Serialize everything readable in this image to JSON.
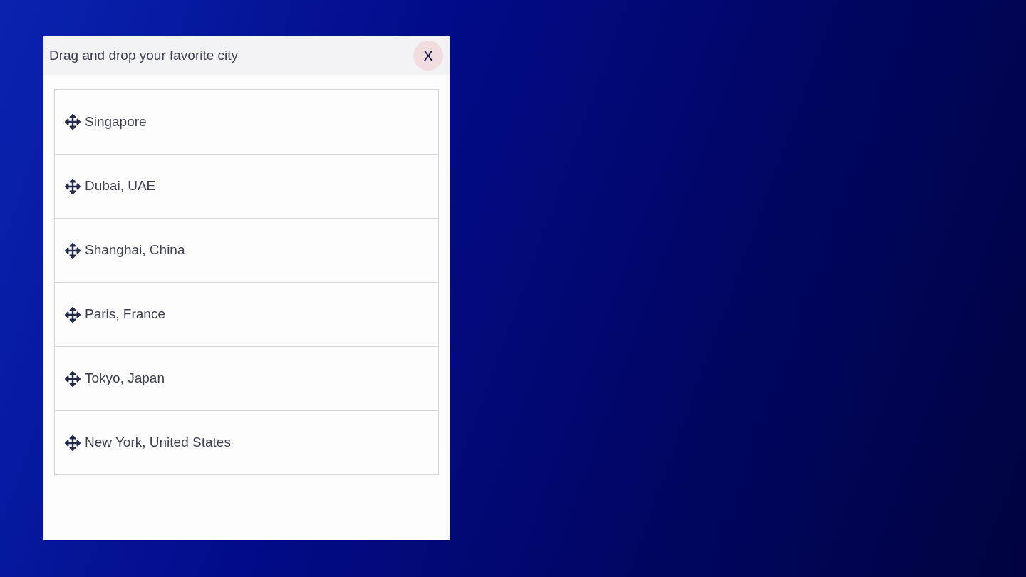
{
  "dialog": {
    "title": "Drag and drop your favorite city",
    "close_label": "X"
  },
  "cities": [
    {
      "label": "Singapore"
    },
    {
      "label": "Dubai, UAE"
    },
    {
      "label": "Shanghai, China"
    },
    {
      "label": "Paris, France"
    },
    {
      "label": "Tokyo, Japan"
    },
    {
      "label": "New York, United States"
    }
  ]
}
